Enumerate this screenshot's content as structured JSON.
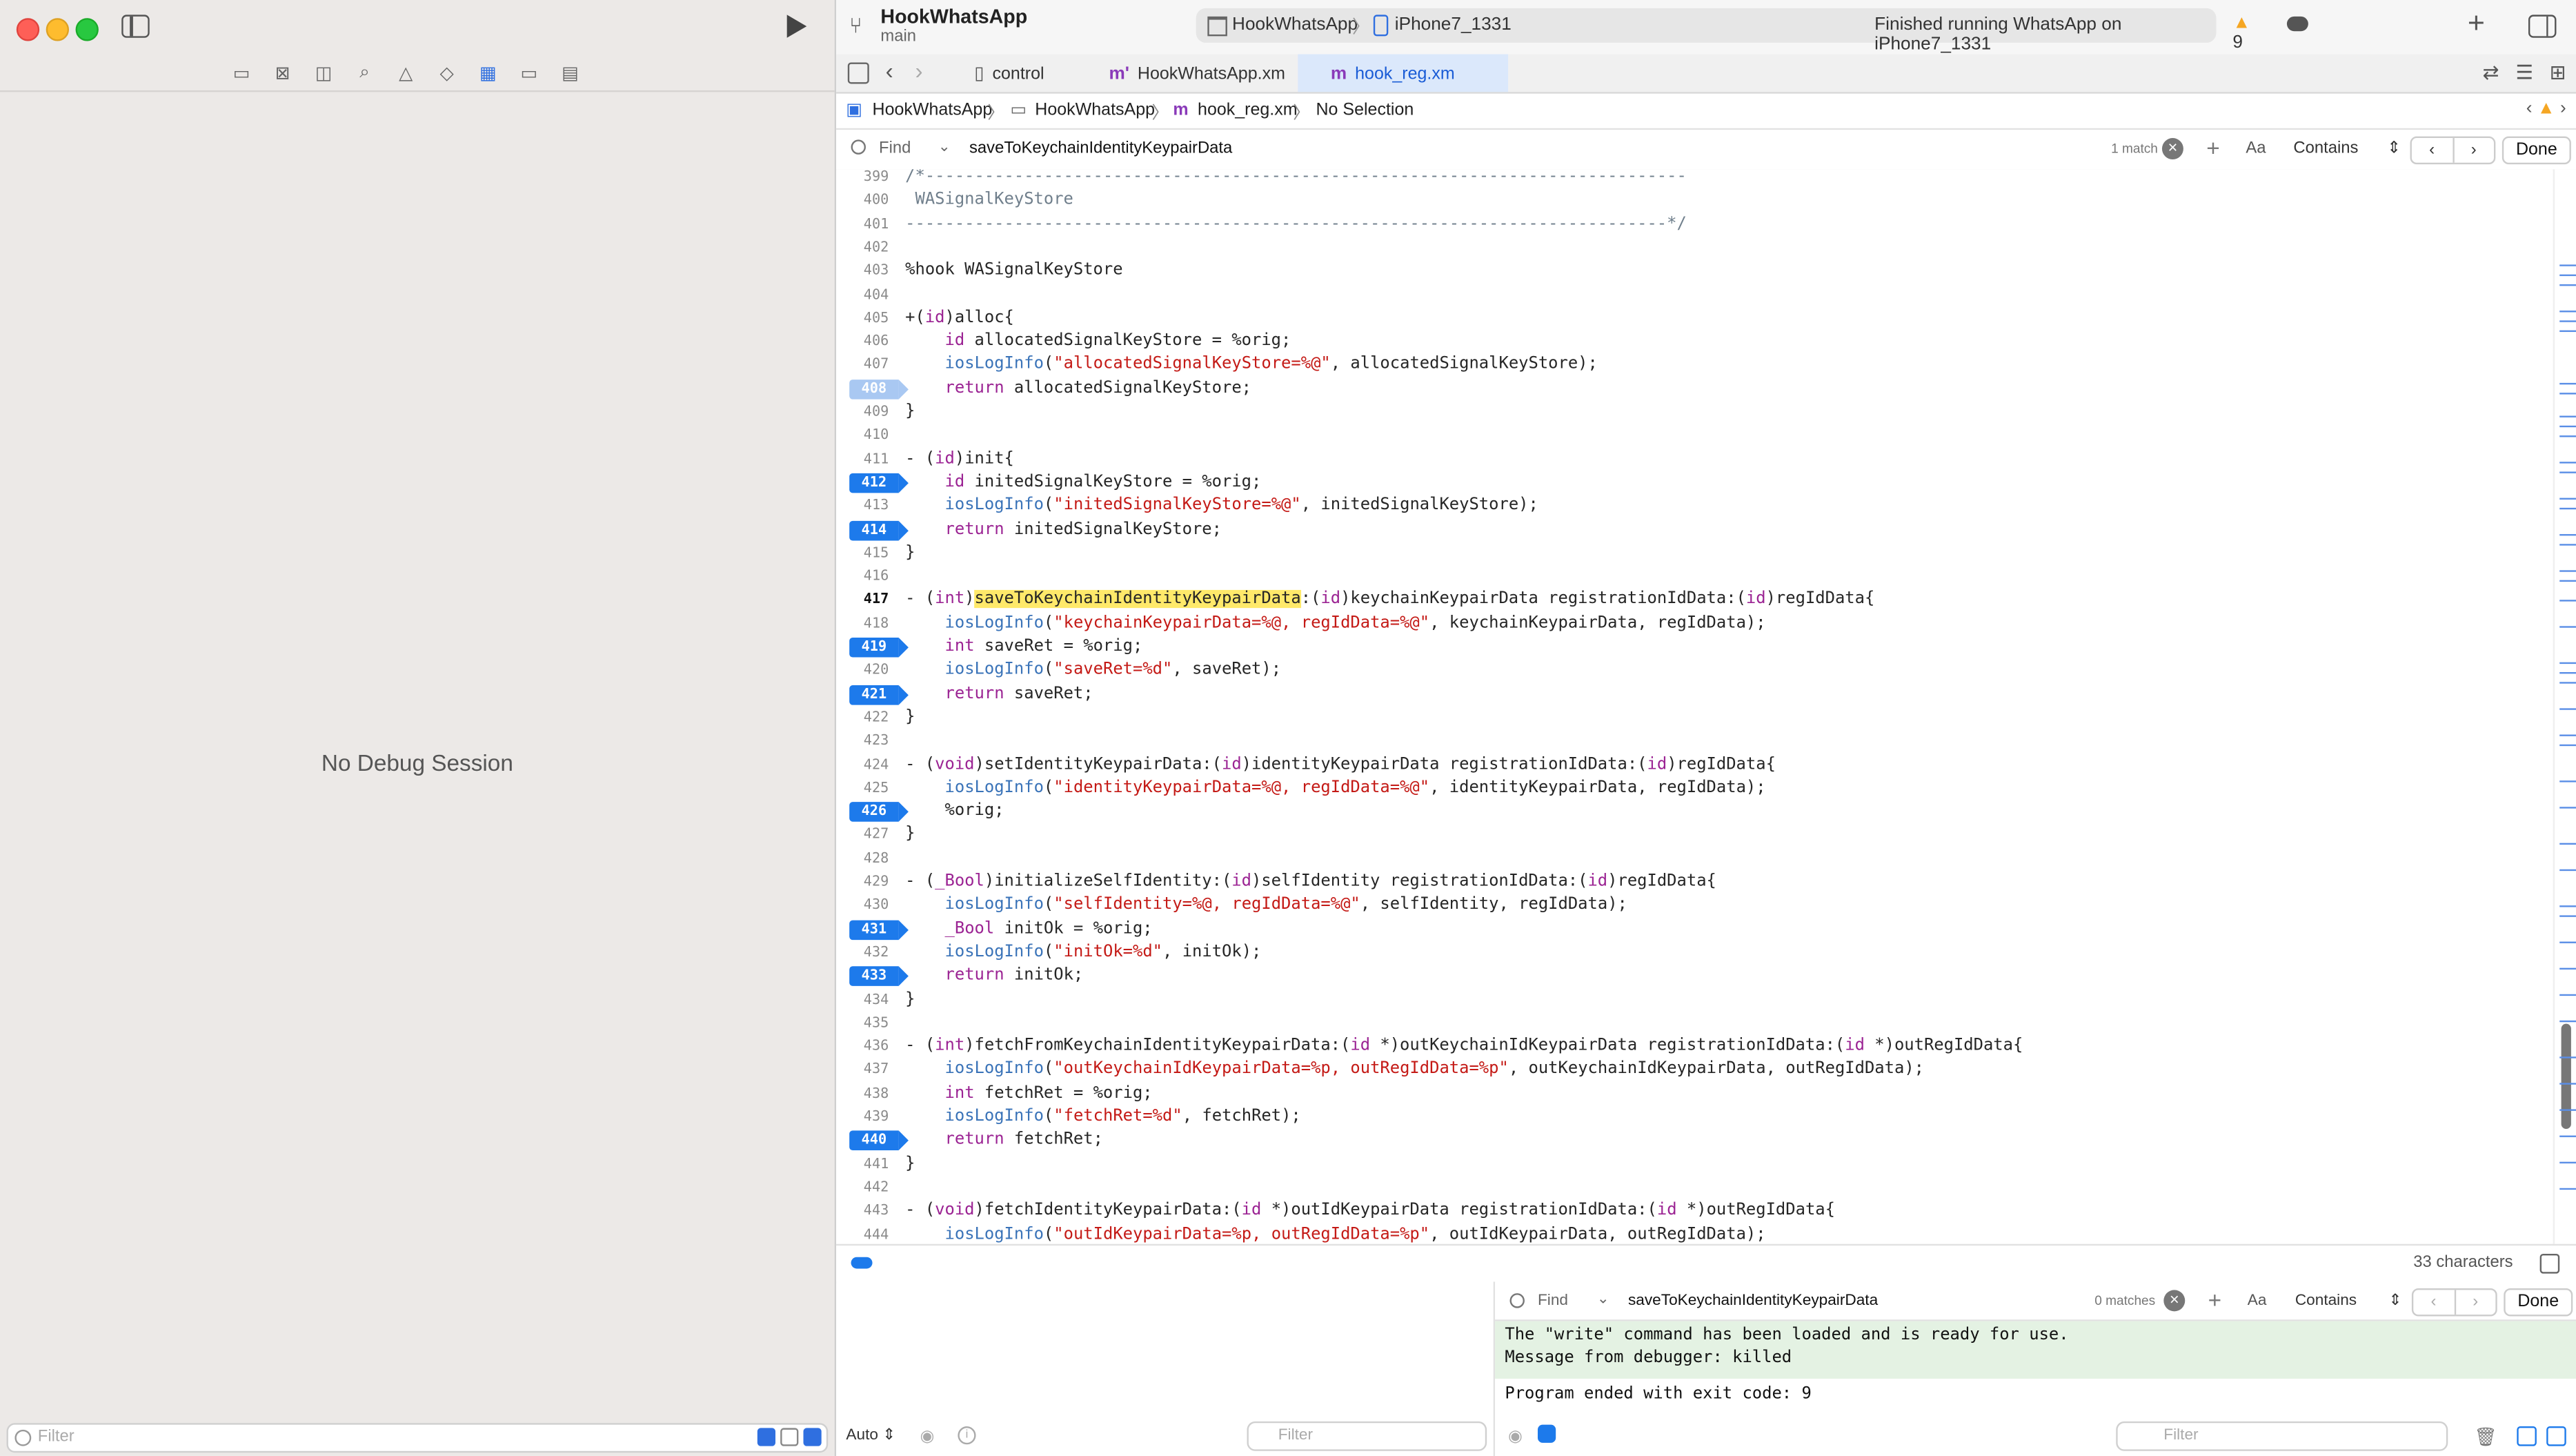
{
  "left_pane": {
    "message": "No Debug Session",
    "filter_placeholder": "Filter",
    "nav_icons": [
      "folder-icon",
      "xmark-square-icon",
      "bookmark-icon",
      "search-icon",
      "warning-icon",
      "diamond-icon",
      "debug-icon",
      "breakpoint-icon",
      "report-icon"
    ]
  },
  "toolbar": {
    "project": "HookWhatsApp",
    "branch": "main",
    "scheme": "HookWhatsApp",
    "device": "iPhone7_1331",
    "status": "Finished running WhatsApp on iPhone7_1331",
    "warnings": "9"
  },
  "tabs": [
    {
      "label": "control",
      "icon": "file-icon"
    },
    {
      "label": "HookWhatsApp.xm",
      "icon": "m"
    },
    {
      "label": "hook_reg.xm",
      "icon": "m"
    }
  ],
  "breadcrumb": [
    "HookWhatsApp",
    "HookWhatsApp",
    "hook_reg.xm",
    "No Selection"
  ],
  "find_bar": {
    "label": "Find",
    "query": "saveToKeychainIdentityKeypairData",
    "match_count": "1 match",
    "case_label": "Aa",
    "mode": "Contains",
    "done": "Done"
  },
  "code_lines": [
    {
      "n": "399",
      "t": "/*-----------------------------------------------------------------------------",
      "bp": ""
    },
    {
      "n": "400",
      "t": " WASignalKeyStore",
      "bp": ""
    },
    {
      "n": "401",
      "t": "-----------------------------------------------------------------------------*/",
      "bp": ""
    },
    {
      "n": "402",
      "t": "",
      "bp": ""
    },
    {
      "n": "403",
      "t": "%hook WASignalKeyStore",
      "bp": ""
    },
    {
      "n": "404",
      "t": "",
      "bp": ""
    },
    {
      "n": "405",
      "t": "+(id)alloc{",
      "bp": ""
    },
    {
      "n": "406",
      "t": "    id allocatedSignalKeyStore = %orig;",
      "bp": ""
    },
    {
      "n": "407",
      "t": "    iosLogInfo(\"allocatedSignalKeyStore=%@\", allocatedSignalKeyStore);",
      "bp": ""
    },
    {
      "n": "408",
      "t": "    return allocatedSignalKeyStore;",
      "bp": "disabled"
    },
    {
      "n": "409",
      "t": "}",
      "bp": ""
    },
    {
      "n": "410",
      "t": "",
      "bp": ""
    },
    {
      "n": "411",
      "t": "- (id)init{",
      "bp": ""
    },
    {
      "n": "412",
      "t": "    id initedSignalKeyStore = %orig;",
      "bp": "active"
    },
    {
      "n": "413",
      "t": "    iosLogInfo(\"initedSignalKeyStore=%@\", initedSignalKeyStore);",
      "bp": ""
    },
    {
      "n": "414",
      "t": "    return initedSignalKeyStore;",
      "bp": "active"
    },
    {
      "n": "415",
      "t": "}",
      "bp": ""
    },
    {
      "n": "416",
      "t": "",
      "bp": ""
    },
    {
      "n": "417",
      "t": "- (int)saveToKeychainIdentityKeypairData:(id)keychainKeypairData registrationIdData:(id)regIdData{",
      "bp": "current"
    },
    {
      "n": "418",
      "t": "    iosLogInfo(\"keychainKeypairData=%@, regIdData=%@\", keychainKeypairData, regIdData);",
      "bp": ""
    },
    {
      "n": "419",
      "t": "    int saveRet = %orig;",
      "bp": "active"
    },
    {
      "n": "420",
      "t": "    iosLogInfo(\"saveRet=%d\", saveRet);",
      "bp": ""
    },
    {
      "n": "421",
      "t": "    return saveRet;",
      "bp": "active"
    },
    {
      "n": "422",
      "t": "}",
      "bp": ""
    },
    {
      "n": "423",
      "t": "",
      "bp": ""
    },
    {
      "n": "424",
      "t": "- (void)setIdentityKeypairData:(id)identityKeypairData registrationIdData:(id)regIdData{",
      "bp": ""
    },
    {
      "n": "425",
      "t": "    iosLogInfo(\"identityKeypairData=%@, regIdData=%@\", identityKeypairData, regIdData);",
      "bp": ""
    },
    {
      "n": "426",
      "t": "    %orig;",
      "bp": "active"
    },
    {
      "n": "427",
      "t": "}",
      "bp": ""
    },
    {
      "n": "428",
      "t": "",
      "bp": ""
    },
    {
      "n": "429",
      "t": "- (_Bool)initializeSelfIdentity:(id)selfIdentity registrationIdData:(id)regIdData{",
      "bp": ""
    },
    {
      "n": "430",
      "t": "    iosLogInfo(\"selfIdentity=%@, regIdData=%@\", selfIdentity, regIdData);",
      "bp": ""
    },
    {
      "n": "431",
      "t": "    _Bool initOk = %orig;",
      "bp": "active"
    },
    {
      "n": "432",
      "t": "    iosLogInfo(\"initOk=%d\", initOk);",
      "bp": ""
    },
    {
      "n": "433",
      "t": "    return initOk;",
      "bp": "active"
    },
    {
      "n": "434",
      "t": "}",
      "bp": ""
    },
    {
      "n": "435",
      "t": "",
      "bp": ""
    },
    {
      "n": "436",
      "t": "- (int)fetchFromKeychainIdentityKeypairData:(id *)outKeychainIdKeypairData registrationIdData:(id *)outRegIdData{",
      "bp": ""
    },
    {
      "n": "437",
      "t": "    iosLogInfo(\"outKeychainIdKeypairData=%p, outRegIdData=%p\", outKeychainIdKeypairData, outRegIdData);",
      "bp": ""
    },
    {
      "n": "438",
      "t": "    int fetchRet = %orig;",
      "bp": ""
    },
    {
      "n": "439",
      "t": "    iosLogInfo(\"fetchRet=%d\", fetchRet);",
      "bp": ""
    },
    {
      "n": "440",
      "t": "    return fetchRet;",
      "bp": "active"
    },
    {
      "n": "441",
      "t": "}",
      "bp": ""
    },
    {
      "n": "442",
      "t": "",
      "bp": ""
    },
    {
      "n": "443",
      "t": "- (void)fetchIdentityKeypairData:(id *)outIdKeypairData registrationIdData:(id *)outRegIdData{",
      "bp": ""
    },
    {
      "n": "444",
      "t": "    iosLogInfo(\"outIdKeypairData=%p, outRegIdData=%p\", outIdKeypairData, outRegIdData);",
      "bp": ""
    }
  ],
  "status_bar": {
    "chars": "33 characters"
  },
  "variables_pane": {
    "mode": "Auto",
    "filter_placeholder": "Filter"
  },
  "console": {
    "find_label": "Find",
    "find_query": "saveToKeychainIdentityKeypairData",
    "match_count": "0 matches",
    "case_label": "Aa",
    "mode": "Contains",
    "done": "Done",
    "lines": [
      "The \"write\" command has been loaded and is ready for use.",
      "Message from debugger: killed",
      "",
      "Program ended with exit code: 9"
    ],
    "filter_placeholder": "Filter"
  },
  "colors": {
    "accent": "#1d7aeb",
    "keyword": "#9b2393",
    "function": "#3a73b8",
    "string": "#c41a16",
    "find_highlight": "#ffe96a"
  }
}
